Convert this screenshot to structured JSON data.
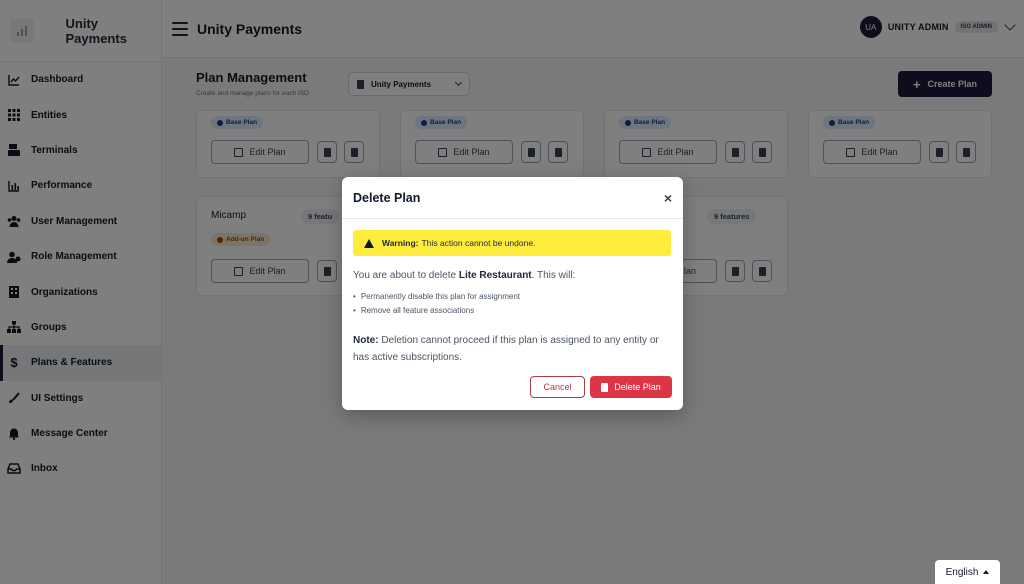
{
  "sidebar": {
    "brand": "Unity Payments",
    "items": [
      {
        "label": "Dashboard",
        "icon": "chart-line-icon"
      },
      {
        "label": "Entities",
        "icon": "grid-icon"
      },
      {
        "label": "Terminals",
        "icon": "terminal-icon"
      },
      {
        "label": "Performance",
        "icon": "bar-chart-icon"
      },
      {
        "label": "User Management",
        "icon": "users-icon"
      },
      {
        "label": "Role Management",
        "icon": "user-cog-icon"
      },
      {
        "label": "Organizations",
        "icon": "building-icon"
      },
      {
        "label": "Groups",
        "icon": "sitemap-icon"
      },
      {
        "label": "Plans & Features",
        "icon": "dollar-icon",
        "active": true
      },
      {
        "label": "UI Settings",
        "icon": "brush-icon"
      },
      {
        "label": "Message Center",
        "icon": "bell-icon"
      },
      {
        "label": "Inbox",
        "icon": "inbox-icon"
      }
    ]
  },
  "topbar": {
    "title": "Unity Payments",
    "avatar_initials": "UA",
    "user_name": "UNITY ADMIN",
    "role_badge": "ISO ADMIN"
  },
  "page": {
    "title": "Plan Management",
    "subtitle": "Create and manage plans for each ISO",
    "iso_select": "Unity Payments",
    "create_label": "Create Plan"
  },
  "cards": {
    "base_label": "Base Plan",
    "addon_label": "Add-on Plan",
    "edit_label": "Edit Plan",
    "micamp_title": "Micamp",
    "micamp_features": "9 featu",
    "other_features": "9 features",
    "partial_edit": "lan"
  },
  "modal": {
    "title": "Delete Plan",
    "close": "×",
    "warning_bold": "Warning:",
    "warning_text": "This action cannot be undone.",
    "intro_pre": "You are about to delete ",
    "intro_plan": "Lite Restaurant",
    "intro_post": ". This will:",
    "bullets": [
      "Permanently disable this plan for assignment",
      "Remove all feature associations"
    ],
    "note_bold": "Note:",
    "note_text": " Deletion cannot proceed if this plan is assigned to any entity or has active subscriptions.",
    "cancel_label": "Cancel",
    "delete_label": "Delete Plan"
  },
  "language": {
    "selected": "English"
  },
  "colors": {
    "primary": "#1e1b3a",
    "danger": "#dc3545",
    "warning": "#ffeb3b"
  }
}
